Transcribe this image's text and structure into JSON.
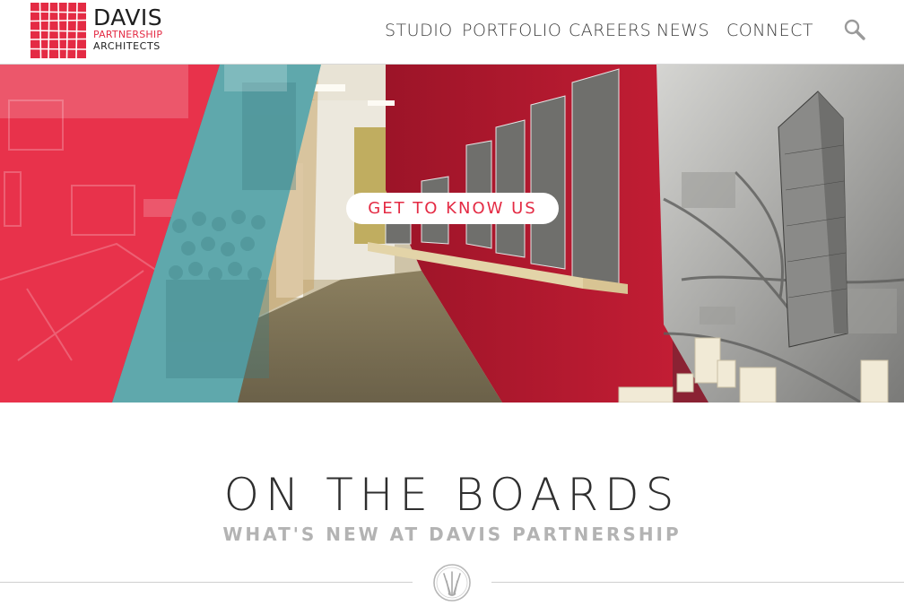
{
  "header": {
    "logo": {
      "line1": "DAVIS",
      "line2": "PARTNERSHIP",
      "line3": "ARCHITECTS",
      "icon": "davis-grid-logo-icon",
      "brand_color": "#e42b44"
    },
    "nav": [
      {
        "label": "STUDIO"
      },
      {
        "label": "PORTFOLIO"
      },
      {
        "label": "CAREERS"
      },
      {
        "label": "NEWS"
      },
      {
        "label": "CONNECT"
      }
    ],
    "search_icon": "search-icon"
  },
  "hero": {
    "cta_label": "GET TO KNOW US",
    "panels": [
      "red-overlay-office-photo",
      "teal-overlay-team-photo",
      "red-hallway-photo",
      "city-model-photo"
    ],
    "colors": {
      "red": "#e42b44",
      "teal": "#5aa3a7",
      "wall_red": "#b5192f"
    }
  },
  "section": {
    "title": "ON THE BOARDS",
    "subtitle": "WHAT'S NEW AT DAVIS PARTNERSHIP",
    "emblem_icon": "brushes-emblem-icon"
  }
}
